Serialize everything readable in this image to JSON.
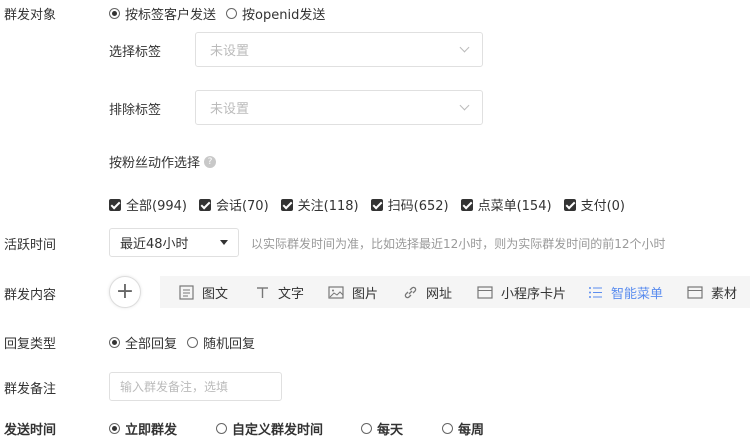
{
  "target": {
    "label": "群发对象",
    "options": [
      "按标签客户发送",
      "按openid发送"
    ],
    "selected": 0
  },
  "tag_select": {
    "label": "选择标签",
    "placeholder": "未设置"
  },
  "tag_exclude": {
    "label": "排除标签",
    "placeholder": "未设置"
  },
  "fans_action": {
    "label": "按粉丝动作选择",
    "help_icon": "?",
    "items": [
      "全部(994)",
      "会话(70)",
      "关注(118)",
      "扫码(652)",
      "点菜单(154)",
      "支付(0)"
    ]
  },
  "active_time": {
    "label": "活跃时间",
    "value": "最近48小时",
    "hint": "以实际群发时间为准，比如选择最近12小时，则为实际群发时间的前12个小时"
  },
  "content": {
    "label": "群发内容",
    "plus": "+",
    "tools": [
      {
        "label": "图文",
        "icon": "article-icon"
      },
      {
        "label": "文字",
        "icon": "text-icon"
      },
      {
        "label": "图片",
        "icon": "image-icon"
      },
      {
        "label": "网址",
        "icon": "link-icon"
      },
      {
        "label": "小程序卡片",
        "icon": "miniprogram-card-icon"
      },
      {
        "label": "智能菜单",
        "icon": "smart-menu-icon",
        "active": true
      },
      {
        "label": "素材",
        "icon": "material-icon"
      }
    ],
    "active_color": "#5b8def"
  },
  "reply_type": {
    "label": "回复类型",
    "options": [
      "全部回复",
      "随机回复"
    ],
    "selected": 0
  },
  "remark": {
    "label": "群发备注",
    "placeholder": "输入群发备注，选填"
  },
  "send_time": {
    "label": "发送时间",
    "options": [
      "立即群发",
      "自定义群发时间",
      "每天",
      "每周"
    ],
    "selected": 0
  }
}
